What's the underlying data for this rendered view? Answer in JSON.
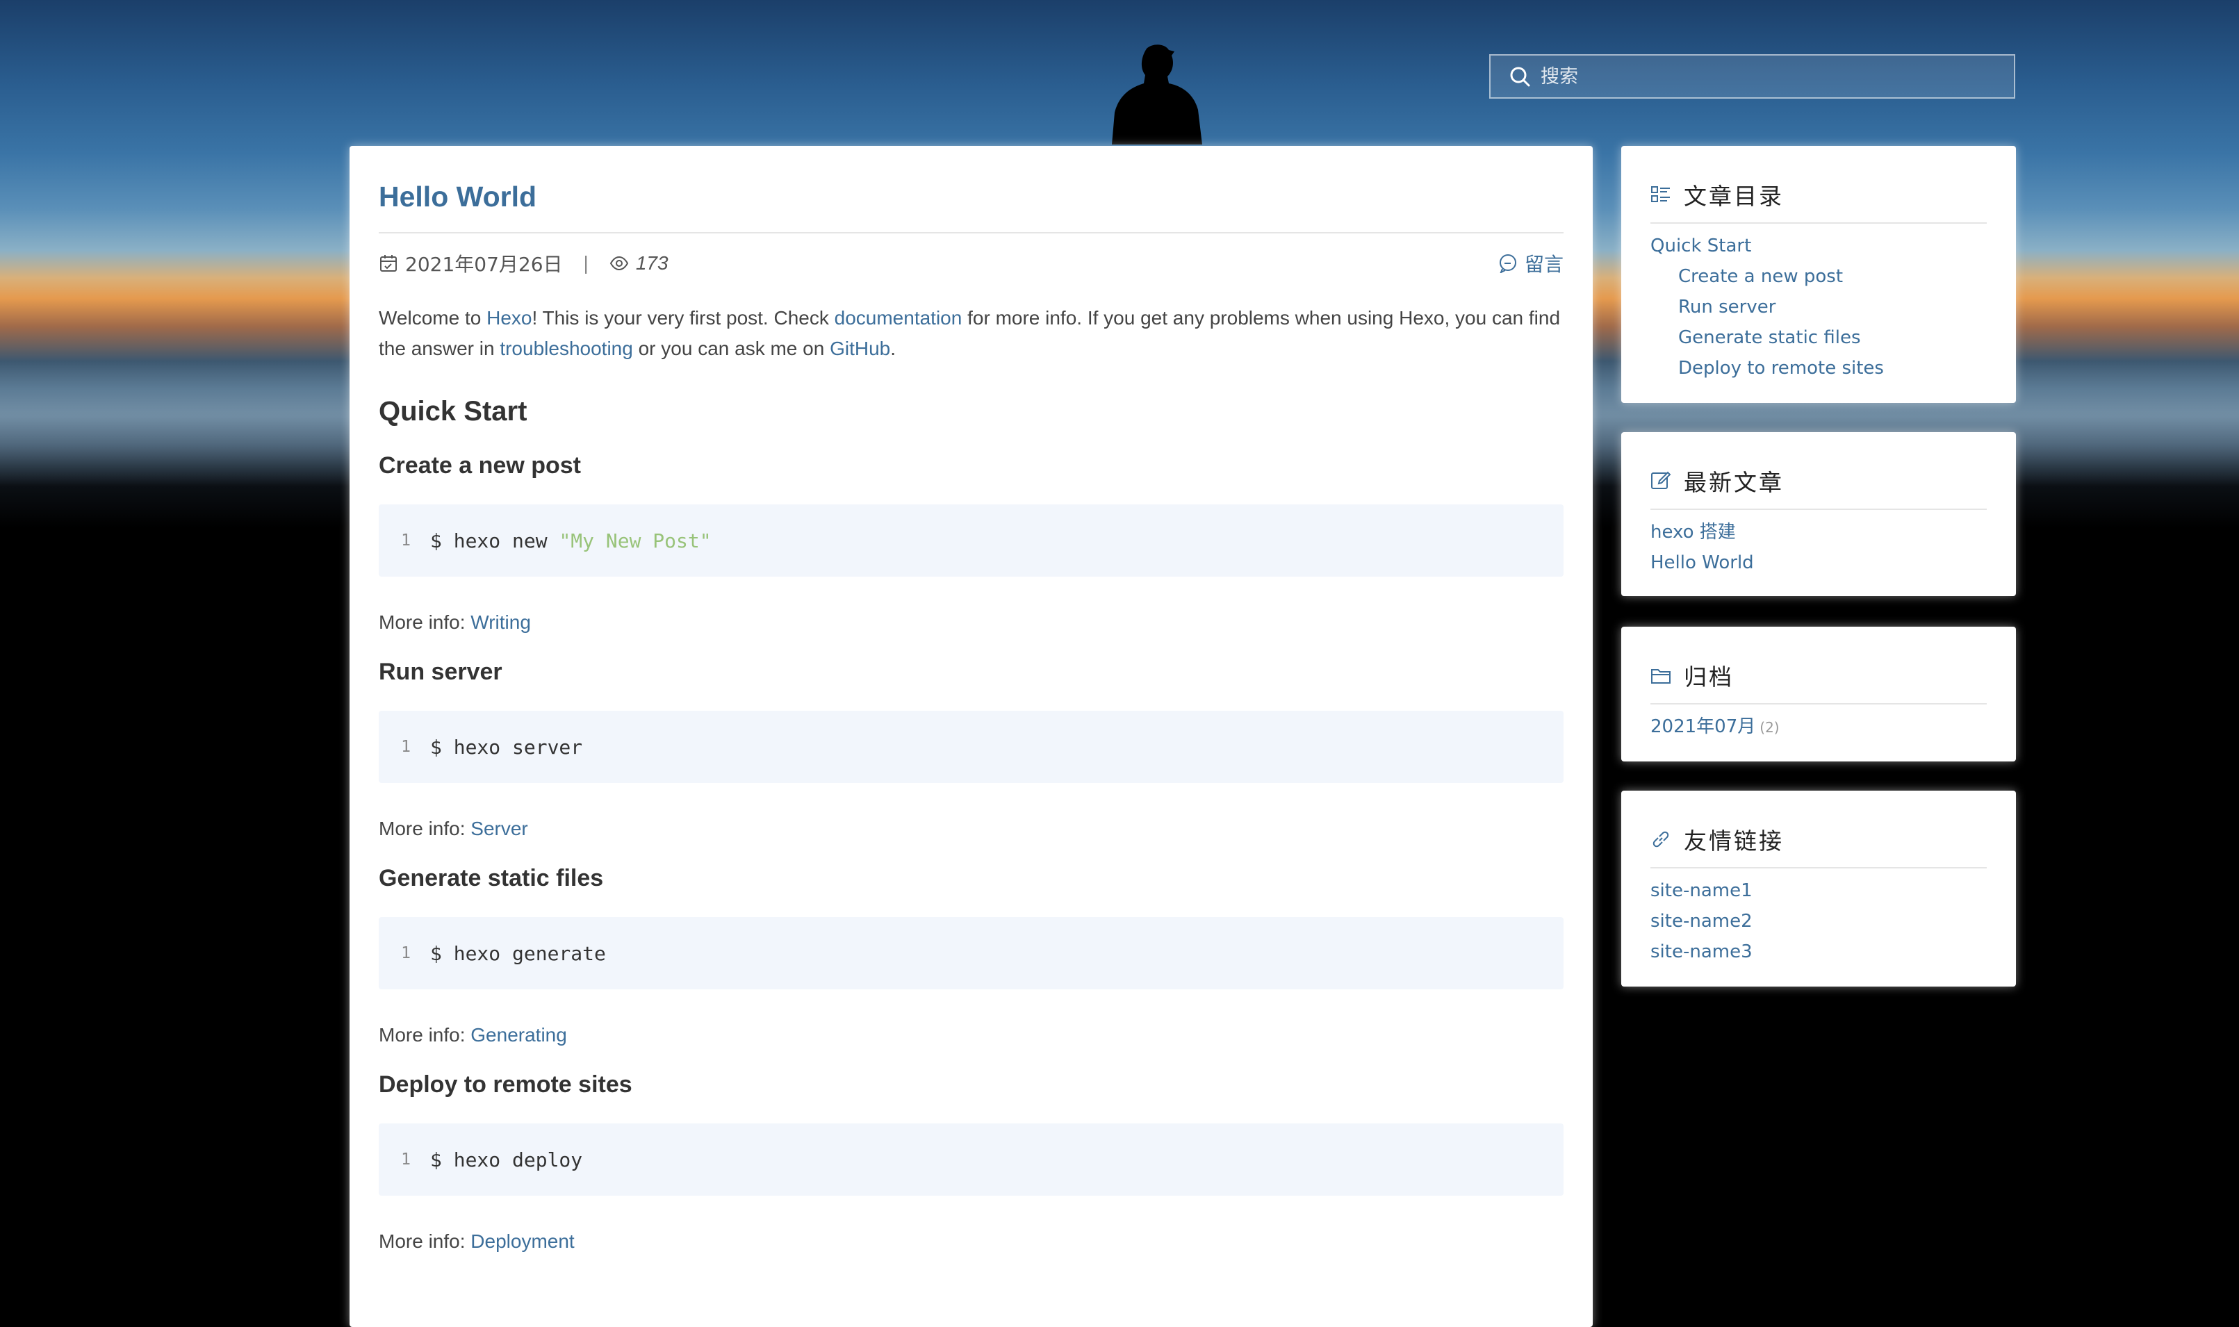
{
  "search": {
    "placeholder": "搜索"
  },
  "article": {
    "title": "Hello World",
    "date": "2021年07月26日",
    "separator": "|",
    "views": "173",
    "comment_label": "留言",
    "intro": {
      "t1": "Welcome to ",
      "l1": "Hexo",
      "t2": "! This is your very first post. Check ",
      "l2": "documentation",
      "t3": " for more info. If you get any problems when using Hexo, you can find the answer in ",
      "l3": "troubleshooting",
      "t4": " or you can ask me on ",
      "l4": "GitHub",
      "t5": "."
    },
    "quick_start": "Quick Start",
    "more_info_label": "More info: ",
    "sections": [
      {
        "heading": "Create a new post",
        "line_no": "1",
        "cmd": "$ hexo new ",
        "arg": "\"My New Post\"",
        "more_link": "Writing"
      },
      {
        "heading": "Run server",
        "line_no": "1",
        "cmd": "$ hexo server",
        "arg": "",
        "more_link": "Server"
      },
      {
        "heading": "Generate static files",
        "line_no": "1",
        "cmd": "$ hexo generate",
        "arg": "",
        "more_link": "Generating"
      },
      {
        "heading": "Deploy to remote sites",
        "line_no": "1",
        "cmd": "$ hexo deploy",
        "arg": "",
        "more_link": "Deployment"
      }
    ]
  },
  "sidebar": {
    "toc": {
      "title": "文章目录",
      "items": [
        "Quick Start",
        "Create a new post",
        "Run server",
        "Generate static files",
        "Deploy to remote sites"
      ]
    },
    "recent": {
      "title": "最新文章",
      "items": [
        "hexo 搭建",
        "Hello World"
      ]
    },
    "archive": {
      "title": "归档",
      "items": [
        {
          "label": "2021年07月",
          "count": "(2)"
        }
      ]
    },
    "friends": {
      "title": "友情链接",
      "items": [
        "site-name1",
        "site-name2",
        "site-name3"
      ]
    }
  },
  "colors": {
    "link": "#3c6e9a",
    "code_bg": "#f2f6fc",
    "string": "#98c379"
  },
  "icons": [
    "search-icon",
    "calendar-icon",
    "eye-icon",
    "comment-icon",
    "list-icon",
    "edit-icon",
    "folder-icon",
    "link-icon"
  ]
}
